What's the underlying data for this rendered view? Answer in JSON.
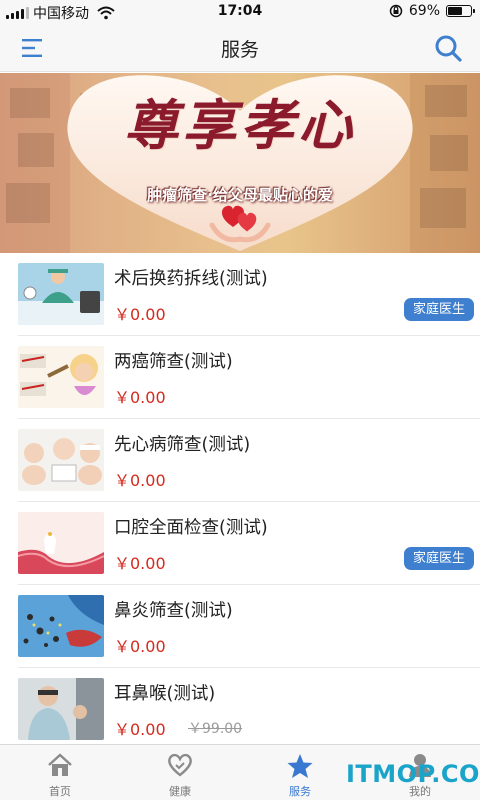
{
  "status_bar": {
    "carrier": "中国移动",
    "time": "17:04",
    "battery_percent": "69%",
    "battery_level": 0.69,
    "signal_bars": 4,
    "icons": [
      "wifi-icon",
      "orientation-lock-icon",
      "battery-icon"
    ]
  },
  "nav": {
    "title": "服务",
    "icons": [
      "menu-icon",
      "search-icon"
    ],
    "accent": "#3f7fcf"
  },
  "banner": {
    "heading": "尊享孝心",
    "tagline": "肿瘤筛查·给父母最贴心的爱",
    "icon": "heart-hands-icon"
  },
  "services": [
    {
      "title": "术后换药拆线(测试)",
      "price": "￥0.00",
      "original_price": "",
      "badge": "家庭医生",
      "thumb": "surgery-thumbnail"
    },
    {
      "title": "两癌筛查(测试)",
      "price": "￥0.00",
      "original_price": "",
      "badge": "",
      "thumb": "cancer-screening-thumbnail"
    },
    {
      "title": "先心病筛查(测试)",
      "price": "￥0.00",
      "original_price": "",
      "badge": "",
      "thumb": "babies-thumbnail"
    },
    {
      "title": "口腔全面检查(测试)",
      "price": "￥0.00",
      "original_price": "",
      "badge": "家庭医生",
      "thumb": "tooth-thumbnail"
    },
    {
      "title": "鼻炎筛查(测试)",
      "price": "￥0.00",
      "original_price": "",
      "badge": "",
      "thumb": "nose-thumbnail"
    },
    {
      "title": "耳鼻喉(测试)",
      "price": "￥0.00",
      "original_price": "￥99.00",
      "badge": "",
      "thumb": "ent-doctor-thumbnail"
    }
  ],
  "colors": {
    "price": "#d42b1e",
    "badge": "#3f7fcf",
    "tab_active": "#3978d0"
  },
  "tabs": [
    {
      "label": "首页",
      "icon": "home-icon",
      "active": false
    },
    {
      "label": "健康",
      "icon": "heart-icon",
      "active": false
    },
    {
      "label": "服务",
      "icon": "star-icon",
      "active": true
    },
    {
      "label": "我的",
      "icon": "user-icon",
      "active": false
    }
  ],
  "watermark": "ITMOP.COM"
}
